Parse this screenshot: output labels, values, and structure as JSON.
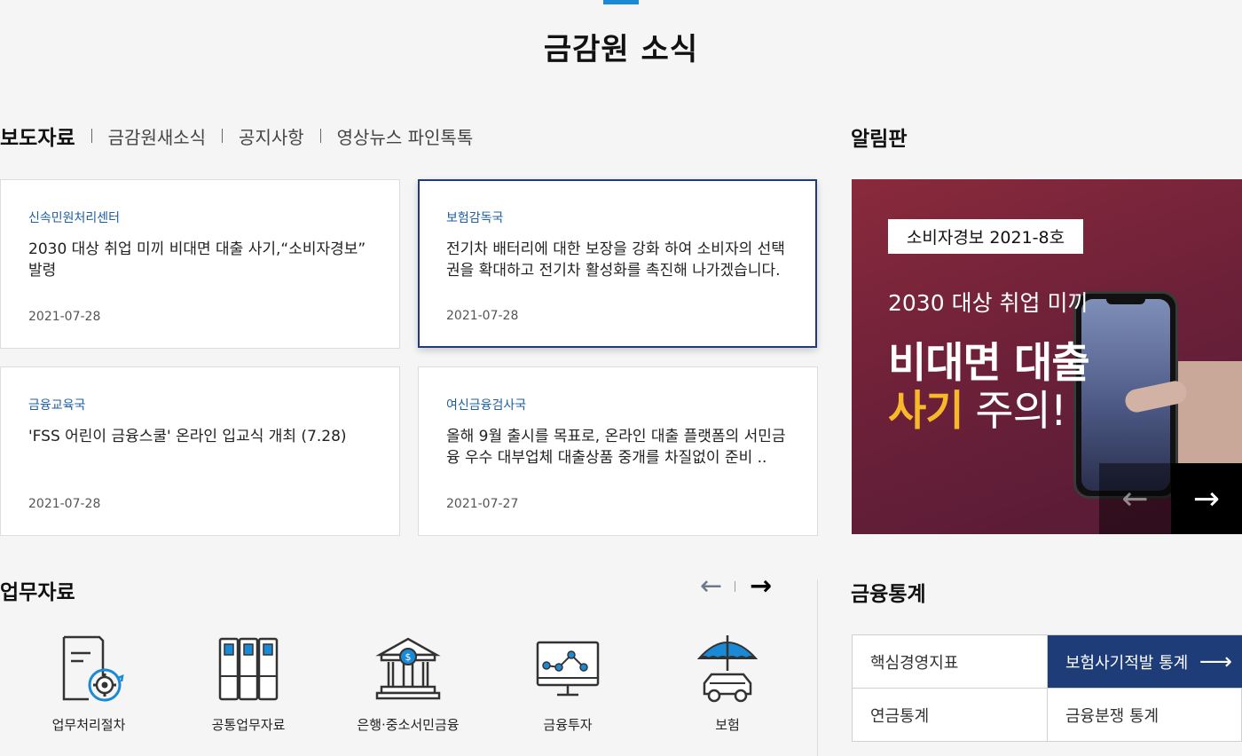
{
  "page_title": "금감원 소식",
  "news": {
    "tabs": [
      {
        "label": "보도자료",
        "active": true
      },
      {
        "label": "금감원새소식",
        "active": false
      },
      {
        "label": "공지사항",
        "active": false
      },
      {
        "label": "영상뉴스 파인톡톡",
        "active": false
      }
    ],
    "cards": [
      {
        "category": "신속민원처리센터",
        "title": "2030 대상 취업 미끼 비대면 대출 사기,“소비자경보” 발령",
        "date": "2021-07-28"
      },
      {
        "category": "보험감독국",
        "title": "전기차 배터리에 대한 보장을 강화 하여 소비자의 선택권을 확대하고 전기차 활성화를 촉진해 나가겠습니다.",
        "date": "2021-07-28"
      },
      {
        "category": "금융교육국",
        "title": "'FSS 어린이 금융스쿨' 온라인 입교식 개최 (7.28)",
        "date": "2021-07-28"
      },
      {
        "category": "여신금융검사국",
        "title": "올해 9월 출시를 목표로, 온라인 대출 플랫폼의 서민금융 우수 대부업체 대출상품 중개를 차질없이 준비 ..",
        "date": "2021-07-27"
      }
    ]
  },
  "notice_board": {
    "title": "알림판",
    "banner": {
      "badge": "소비자경보 2021-8호",
      "subtitle": "2030 대상 취업 미끼",
      "headline1": "비대면 대출",
      "headline2_highlight": "사기",
      "headline2_rest": " 주의!",
      "prev_icon": "←",
      "next_icon": "→"
    }
  },
  "work_materials": {
    "title": "업무자료",
    "prev_icon": "←",
    "next_icon": "→",
    "items": [
      {
        "label": "업무처리절차",
        "icon": "document-gear-icon"
      },
      {
        "label": "공통업무자료",
        "icon": "binders-icon"
      },
      {
        "label": "은행·중소서민금융",
        "icon": "bank-icon"
      },
      {
        "label": "금융투자",
        "icon": "monitor-chart-icon"
      },
      {
        "label": "보험",
        "icon": "umbrella-car-icon"
      }
    ]
  },
  "financial_stats": {
    "title": "금융통계",
    "items": [
      {
        "label": "핵심경영지표",
        "active": false
      },
      {
        "label": "보험사기적발 통계",
        "active": true,
        "arrow": "⟶"
      },
      {
        "label": "연금통계",
        "active": false
      },
      {
        "label": "금융분쟁 통계",
        "active": false
      }
    ],
    "colors": {
      "active_bg": "#1e3c78"
    }
  },
  "colors": {
    "accent": "#1a8ad8",
    "category_text": "#1d5fa5",
    "highlight": "#f7b82a"
  }
}
